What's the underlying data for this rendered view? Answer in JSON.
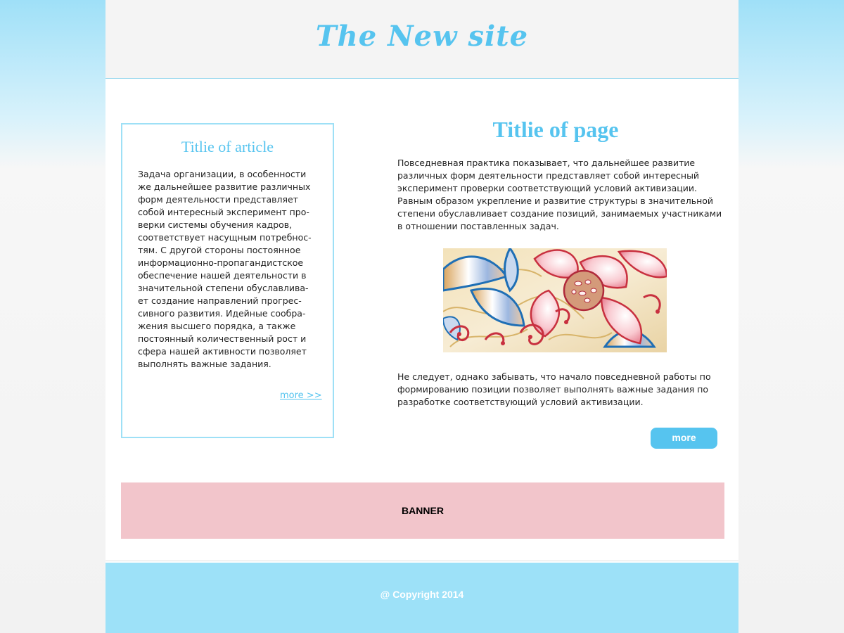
{
  "header": {
    "site_title": "The New site"
  },
  "article": {
    "title": "Titlie of article",
    "text": "Задача организации, в особенности же дальнейшее развитие различных форм деятельности представляет собой интересный эксперимент про­верки системы обучения кадров, соответствует насущным потребнос­тям. С другой стороны постоянное информационно-пропагандистское обеспечение нашей деятельности в значительной степени обуславлива­ет создание направлений прогрес­сивного развития. Идейные сообра­жения высшего порядка, а также постоянный количественный рост и сфера нашей активности позволяет выполнять важные задания.",
    "more_link": "more >>"
  },
  "main": {
    "title": "Titlie of page",
    "intro": "Повседневная практика показывает, что дальнейшее развитие различных форм деятельности представляет собой интересный эксперимент проверки соответствующий условий активизации. Равным образом укрепление и развитие структуры в значительной степени обуславливает создание позиций, занимаемых участниками в отношении поставленных задач.",
    "outro": "Не следует, однако забывать, что начало повседневной работы по формированию позиции позволяет выполнять важные задания по разработке соответствующий условий активизации.",
    "more_button": "more"
  },
  "banner": {
    "label": "BANNER"
  },
  "footer": {
    "copyright": "@ Copyright 2014"
  },
  "colors": {
    "accent": "#56c4ef",
    "footer_bg": "#9de1f8",
    "banner_bg": "#f2c5cb",
    "header_bg": "#f4f4f4"
  },
  "icons": {
    "illustration": "floral-pattern-image"
  }
}
